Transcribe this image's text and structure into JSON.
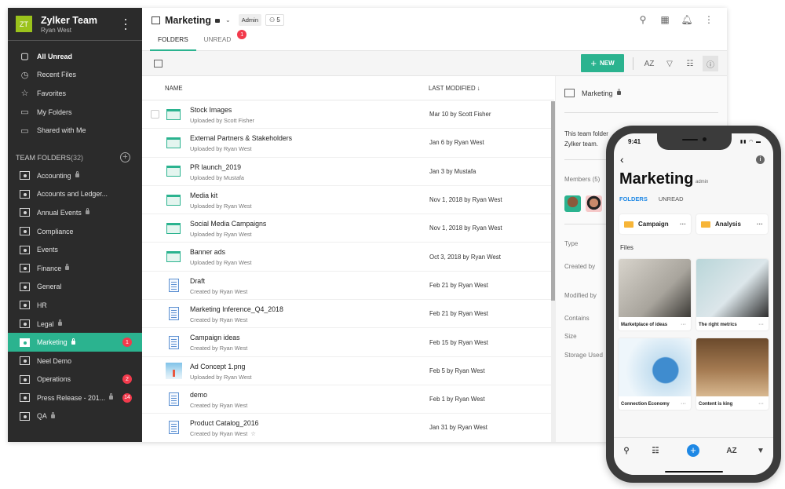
{
  "sidebar": {
    "team_initials": "ZT",
    "team_name": "Zylker Team",
    "user_name": "Ryan West",
    "nav": [
      {
        "label": "All Unread",
        "icon": "unread-icon"
      },
      {
        "label": "Recent Files",
        "icon": "clock-icon"
      },
      {
        "label": "Favorites",
        "icon": "star-icon"
      },
      {
        "label": "My Folders",
        "icon": "folder-icon"
      },
      {
        "label": "Shared with Me",
        "icon": "shared-folder-icon"
      }
    ],
    "team_folders_label": "TEAM FOLDERS",
    "team_folders_count": "(32)",
    "team_folders": [
      {
        "label": "Accounting",
        "locked": true,
        "badge": ""
      },
      {
        "label": "Accounts and Ledger...",
        "locked": false,
        "badge": ""
      },
      {
        "label": "Annual Events",
        "locked": true,
        "badge": ""
      },
      {
        "label": "Compliance",
        "locked": false,
        "badge": ""
      },
      {
        "label": "Events",
        "locked": false,
        "badge": ""
      },
      {
        "label": "Finance",
        "locked": true,
        "badge": ""
      },
      {
        "label": "General",
        "locked": false,
        "badge": ""
      },
      {
        "label": "HR",
        "locked": false,
        "badge": ""
      },
      {
        "label": "Legal",
        "locked": true,
        "badge": ""
      },
      {
        "label": "Marketing",
        "locked": true,
        "badge": "1",
        "active": true
      },
      {
        "label": "Neel Demo",
        "locked": false,
        "badge": ""
      },
      {
        "label": "Operations",
        "locked": false,
        "badge": "2"
      },
      {
        "label": "Press Release - 201...",
        "locked": true,
        "badge": "14"
      },
      {
        "label": "QA",
        "locked": true,
        "badge": ""
      }
    ]
  },
  "header": {
    "title": "Marketing",
    "role_badge": "Admin",
    "members_count": "5",
    "tabs": [
      {
        "label": "FOLDERS",
        "active": true
      },
      {
        "label": "UNREAD",
        "badge": "1"
      }
    ]
  },
  "toolbar": {
    "new_label": "NEW",
    "sort_label": "AZ"
  },
  "list": {
    "col_name": "NAME",
    "col_modified": "LAST MODIFIED",
    "rows": [
      {
        "name": "Stock Images",
        "sub": "Uploaded by Scott Fisher",
        "modified": "Mar 10 by Scott Fisher",
        "type": "folder"
      },
      {
        "name": "External Partners & Stakeholders",
        "sub": "Uploaded by Ryan West",
        "modified": "Jan 6 by Ryan West",
        "type": "folder"
      },
      {
        "name": "PR launch_2019",
        "sub": "Uploaded by Mustafa",
        "modified": "Jan 3 by Mustafa",
        "type": "folder"
      },
      {
        "name": "Media kit",
        "sub": "Uploaded by Ryan West",
        "modified": "Nov 1, 2018 by Ryan West",
        "type": "folder"
      },
      {
        "name": "Social Media Campaigns",
        "sub": "Uploaded by Ryan West",
        "modified": "Nov 1, 2018 by Ryan West",
        "type": "folder"
      },
      {
        "name": "Banner ads",
        "sub": "Uploaded by Ryan West",
        "modified": "Oct 3, 2018 by Ryan West",
        "type": "folder"
      },
      {
        "name": "Draft",
        "sub": "Created by Ryan West",
        "modified": "Feb 21 by Ryan West",
        "type": "doc"
      },
      {
        "name": "Marketing Inference_Q4_2018",
        "sub": "Created by Ryan West",
        "modified": "Feb 21 by Ryan West",
        "type": "doc"
      },
      {
        "name": "Campaign ideas",
        "sub": "Created by Ryan West",
        "modified": "Feb 15 by Ryan West",
        "type": "doc"
      },
      {
        "name": "Ad Concept 1.png",
        "sub": "Uploaded by Ryan West",
        "modified": "Feb 5 by Ryan West",
        "type": "image"
      },
      {
        "name": "demo",
        "sub": "Created by Ryan West",
        "modified": "Feb 1 by Ryan West",
        "type": "doc"
      },
      {
        "name": "Product Catalog_2016",
        "sub": "Created by Ryan West",
        "modified": "Jan 31 by Ryan West",
        "type": "doc",
        "starred": true
      }
    ]
  },
  "details": {
    "title": "Marketing",
    "description": "This team folder Zylker team.",
    "members_label": "Members (5)",
    "fields": [
      "Type",
      "Created by",
      "Modified by",
      "Contains",
      "Size",
      "Storage Used"
    ]
  },
  "phone": {
    "time": "9:41",
    "title": "Marketing",
    "role": "admin",
    "tabs": [
      "FOLDERS",
      "UNREAD"
    ],
    "folders": [
      "Campaign",
      "Analysis"
    ],
    "files_label": "Files",
    "files": [
      "Marketplace of ideas",
      "The right metrics",
      "Connection Economy",
      "Content is king"
    ],
    "sort_label": "AZ"
  },
  "colors": {
    "accent": "#2bb38f",
    "badge": "#f23a4c",
    "sidebar_bg": "#2b2b2b",
    "logo": "#9bc31c",
    "mobile_accent": "#1e88e5"
  }
}
